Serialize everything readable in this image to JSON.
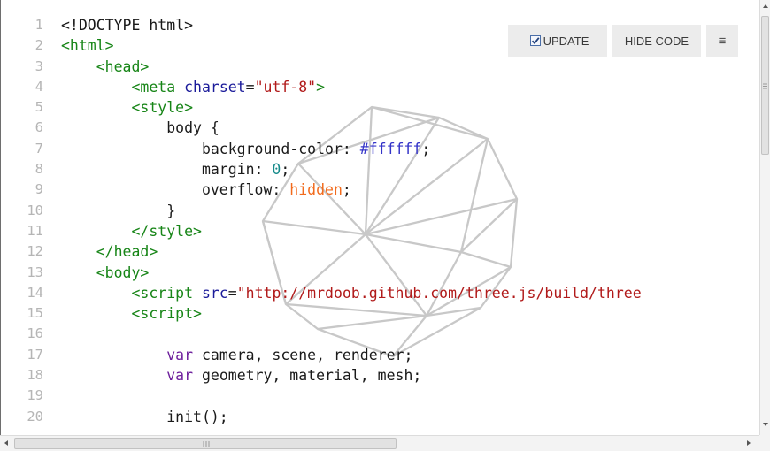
{
  "toolbar": {
    "update_label": "UPDATE",
    "update_checked": true,
    "hide_code_label": "HIDE CODE",
    "menu_glyph": "≡"
  },
  "editor": {
    "line_numbers": [
      "1",
      "2",
      "3",
      "4",
      "5",
      "6",
      "7",
      "8",
      "9",
      "10",
      "11",
      "12",
      "13",
      "14",
      "15",
      "16",
      "17",
      "18",
      "19",
      "20"
    ],
    "lines": [
      [
        {
          "t": "<!DOCTYPE html>",
          "c": "plain"
        }
      ],
      [
        {
          "t": "<html>",
          "c": "tag"
        }
      ],
      [
        {
          "t": "    <head>",
          "c": "tag"
        }
      ],
      [
        {
          "t": "        <meta ",
          "c": "tag"
        },
        {
          "t": "charset",
          "c": "attr"
        },
        {
          "t": "=",
          "c": "plain"
        },
        {
          "t": "\"utf-8\"",
          "c": "str"
        },
        {
          "t": ">",
          "c": "tag"
        }
      ],
      [
        {
          "t": "        <style>",
          "c": "tag"
        }
      ],
      [
        {
          "t": "            body {",
          "c": "plain"
        }
      ],
      [
        {
          "t": "                background-color: ",
          "c": "plain"
        },
        {
          "t": "#ffffff",
          "c": "hex"
        },
        {
          "t": ";",
          "c": "plain"
        }
      ],
      [
        {
          "t": "                margin: ",
          "c": "plain"
        },
        {
          "t": "0",
          "c": "num"
        },
        {
          "t": ";",
          "c": "plain"
        }
      ],
      [
        {
          "t": "                overflow: ",
          "c": "plain"
        },
        {
          "t": "hidden",
          "c": "val"
        },
        {
          "t": ";",
          "c": "plain"
        }
      ],
      [
        {
          "t": "            }",
          "c": "plain"
        }
      ],
      [
        {
          "t": "        </style>",
          "c": "tag"
        }
      ],
      [
        {
          "t": "    </head>",
          "c": "tag"
        }
      ],
      [
        {
          "t": "    <body>",
          "c": "tag"
        }
      ],
      [
        {
          "t": "        <script ",
          "c": "tag"
        },
        {
          "t": "src",
          "c": "attr"
        },
        {
          "t": "=",
          "c": "plain"
        },
        {
          "t": "\"http://mrdoob.github.com/three.js/build/three",
          "c": "str"
        }
      ],
      [
        {
          "t": "        <script>",
          "c": "tag"
        }
      ],
      [
        {
          "t": "",
          "c": "plain"
        }
      ],
      [
        {
          "t": "            ",
          "c": "plain"
        },
        {
          "t": "var",
          "c": "kw"
        },
        {
          "t": " camera, scene, renderer;",
          "c": "plain"
        }
      ],
      [
        {
          "t": "            ",
          "c": "plain"
        },
        {
          "t": "var",
          "c": "kw"
        },
        {
          "t": " geometry, material, mesh;",
          "c": "plain"
        }
      ],
      [
        {
          "t": "",
          "c": "plain"
        }
      ],
      [
        {
          "t": "            init();",
          "c": "plain"
        }
      ]
    ]
  },
  "icons": {
    "checkbox": "checkbox-checked-icon",
    "menu": "hamburger-menu-icon",
    "preview": "icosahedron-wireframe"
  },
  "colors": {
    "tag": "#178517",
    "attr": "#1b1b9a",
    "string": "#b11a1a",
    "keyword": "#6d1f9c",
    "hex": "#3434c8",
    "number": "#158a8a",
    "value": "#f26b1d",
    "line_number": "#b5b5b5",
    "button_bg": "#ececec",
    "wireframe": "#c8c8c8"
  }
}
